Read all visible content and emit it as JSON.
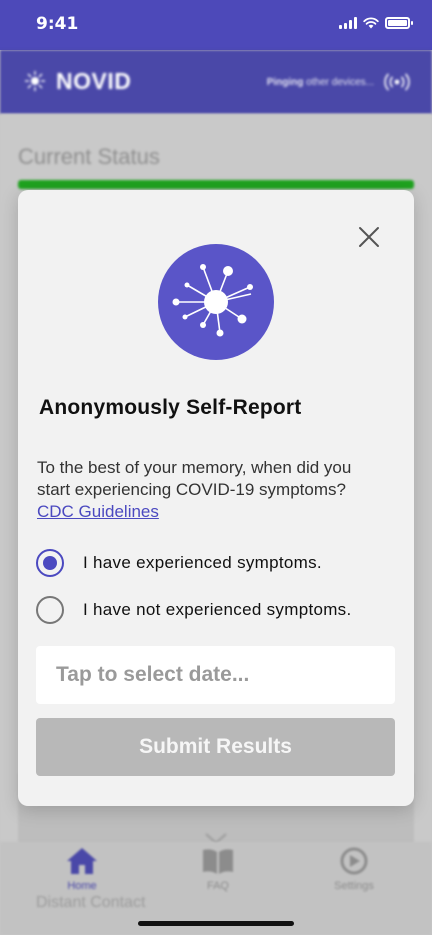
{
  "status_bar": {
    "time": "9:41"
  },
  "header": {
    "brand": "NOVID",
    "pinging_bold": "Pinging",
    "pinging_rest": " other devices..."
  },
  "background": {
    "current_status": "Current Status",
    "distant_contact": "Distant Contact"
  },
  "tabs": [
    {
      "label": "Home",
      "icon": "home-icon"
    },
    {
      "label": "FAQ",
      "icon": "book-icon"
    },
    {
      "label": "Settings",
      "icon": "settings-icon"
    }
  ],
  "modal": {
    "title": "Anonymously Self-Report",
    "description": "To the best of your memory, when did you start experiencing COVID-19 symptoms?",
    "link_text": "CDC Guidelines",
    "options": [
      {
        "label": "I have experienced symptoms.",
        "selected": true
      },
      {
        "label": "I have not experienced symptoms.",
        "selected": false
      }
    ],
    "date_placeholder": "Tap to select date...",
    "submit_label": "Submit Results"
  },
  "colors": {
    "primary": "#4b49c0",
    "status_green": "#1fa31f",
    "disabled": "#b8b8b8"
  }
}
